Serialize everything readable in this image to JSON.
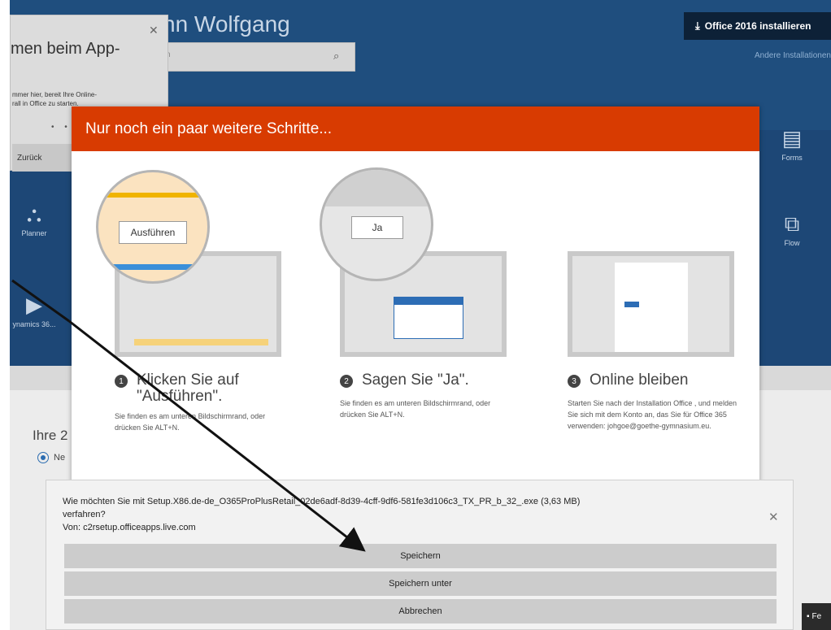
{
  "header": {
    "user_name_fragment": "nn Wolfgang",
    "search_placeholder": "n",
    "install_button_label": "Office 2016 installieren",
    "other_installs_link": "Andere Installationen"
  },
  "popup": {
    "title_fragment": "men beim App-",
    "text_line1": "mmer hier, bereit Ihre Online-",
    "text_line2": "rall in Office zu starten.",
    "dots": "• •",
    "back_button_label": "Zurück"
  },
  "tiles": {
    "forms_label": "Forms",
    "planner_label": "Planner",
    "flow_label": "Flow",
    "dynamics_label": "ynamics 36..."
  },
  "background": {
    "bottom_heading_fragment": "Ihre 2",
    "bottom_radio_fragment": "Ne"
  },
  "modal": {
    "title": "Nur noch ein paar weitere Schritte...",
    "steps": [
      {
        "number": "1",
        "title": "Klicken Sie auf \"Ausführen\".",
        "desc": "Sie finden es am unteren Bildschirmrand, oder drücken Sie ALT+N.",
        "zoom_button_label": "Ausführen"
      },
      {
        "number": "2",
        "title": "Sagen Sie \"Ja\".",
        "desc": "Sie finden es am unteren Bildschirmrand, oder drücken Sie ALT+N.",
        "zoom_button_label": "Ja"
      },
      {
        "number": "3",
        "title": "Online bleiben",
        "desc": "Starten Sie nach der Installation Office , und melden Sie sich mit dem Konto an, das Sie für Office 365 verwenden: johgoe@goethe-gymnasium.eu."
      }
    ]
  },
  "download_bar": {
    "question_line1": "Wie möchten Sie mit Setup.X86.de-de_O365ProPlusRetail_02de6adf-8d39-4cff-9df6-581fe3d106c3_TX_PR_b_32_.exe (3,63 MB)",
    "question_line2": "verfahren?",
    "source": "Von: c2rsetup.officeapps.live.com",
    "save_label": "Speichern",
    "save_as_label": "Speichern unter",
    "cancel_label": "Abbrechen"
  },
  "feedback_label": "Fe"
}
